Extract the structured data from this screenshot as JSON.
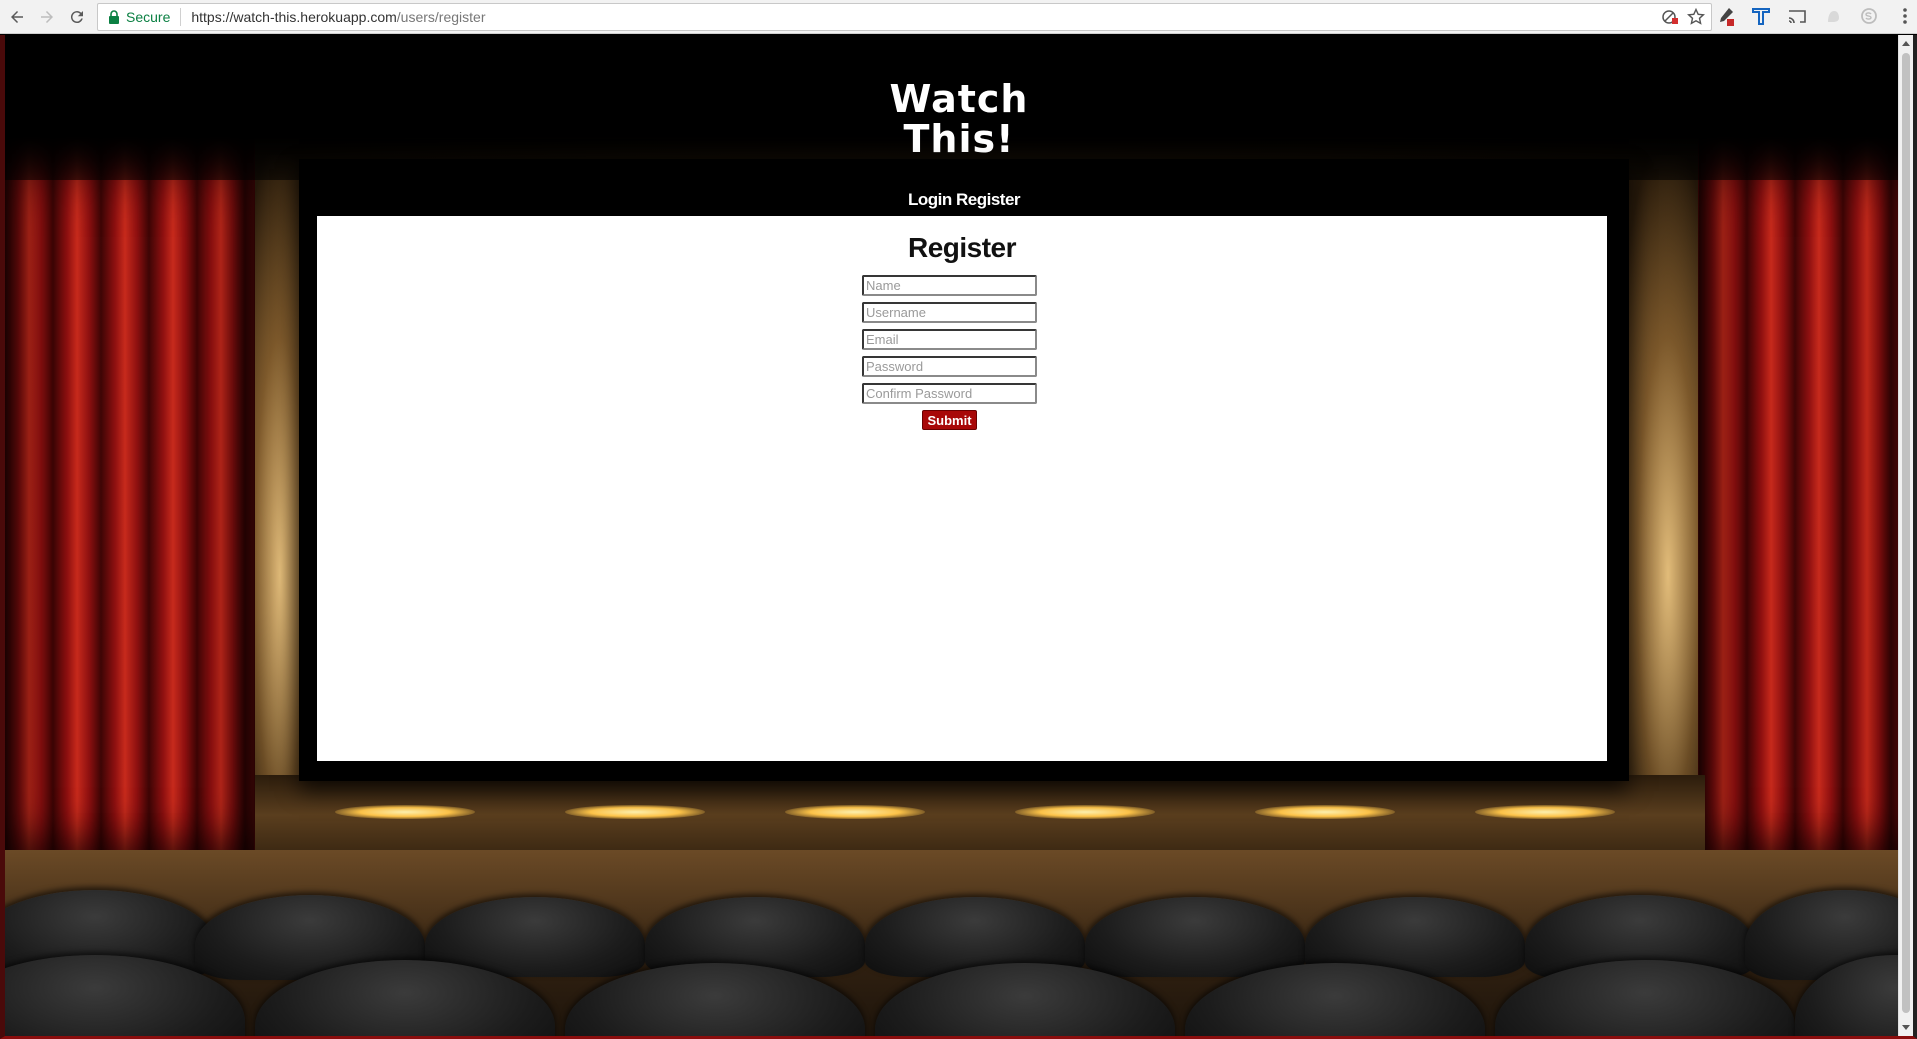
{
  "browser": {
    "secure_label": "Secure",
    "url_host": "https://watch-this.herokuapp.com",
    "url_path": "/users/register",
    "icons": [
      "back-arrow-icon",
      "forward-arrow-icon",
      "reload-icon",
      "lock-icon",
      "shield-block-icon",
      "star-icon",
      "eyedropper-icon",
      "translate-icon",
      "cast-icon",
      "ghost-extension-icon",
      "skype-icon",
      "menu-dots-icon"
    ]
  },
  "site": {
    "logo_line1": "Watch",
    "logo_line2": "This!",
    "nav": {
      "login_label": "Login",
      "register_label": "Register"
    }
  },
  "register_form": {
    "title": "Register",
    "fields": {
      "name_placeholder": "Name",
      "username_placeholder": "Username",
      "email_placeholder": "Email",
      "password_placeholder": "Password",
      "confirm_password_placeholder": "Confirm Password"
    },
    "submit_label": "Submit"
  },
  "colors": {
    "submit_button": "#a80808",
    "secure_green": "#0b8043",
    "curtain_red": "#c72a1c"
  }
}
